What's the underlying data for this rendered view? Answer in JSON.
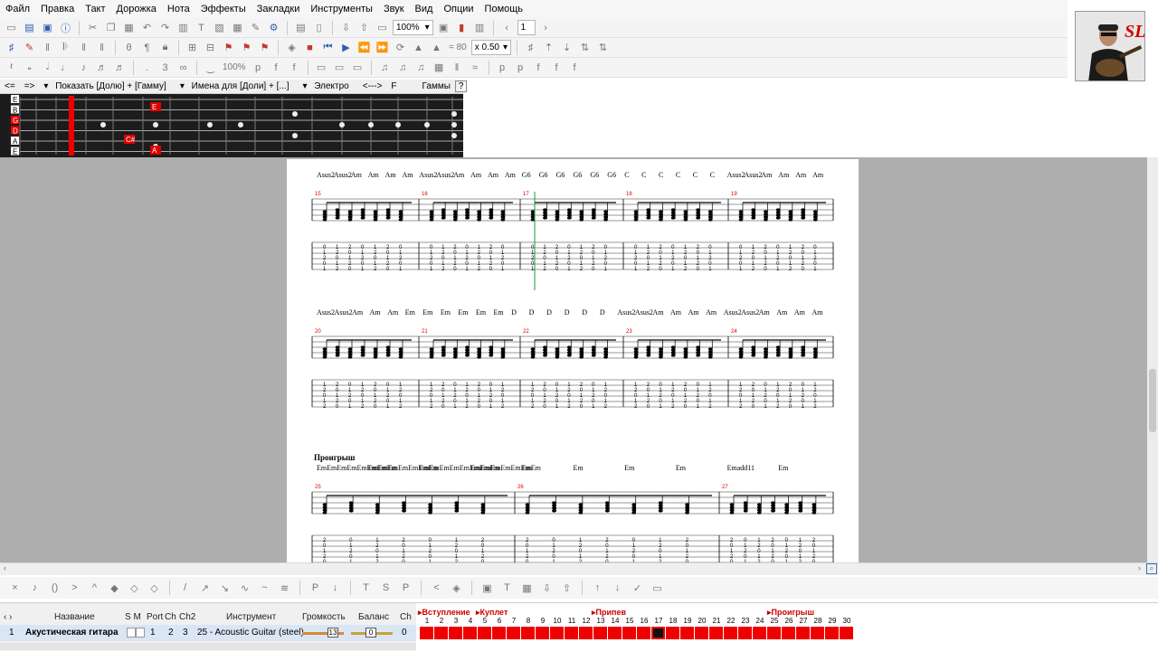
{
  "menu": [
    "Файл",
    "Правка",
    "Такт",
    "Дорожка",
    "Нота",
    "Эффекты",
    "Закладки",
    "Инструменты",
    "Звук",
    "Вид",
    "Опции",
    "Помощь"
  ],
  "toolbar1": {
    "zoom": "100%",
    "page": "1"
  },
  "toolbar2": {
    "tempo": "= 80",
    "speed": "x 0.50"
  },
  "toolbar3": {
    "zoom2": "100%"
  },
  "fretbar": {
    "prev": "<=",
    "next": "=>",
    "show": "Показать [Долю] + [Гамму]",
    "names": "Имена для [Доли] + [...]",
    "sound": "Электро",
    "arrows": "<--->",
    "key": "F",
    "scales": "Гаммы",
    "help": "?"
  },
  "fretboard": {
    "strings": [
      "E",
      "B",
      "G",
      "D",
      "A",
      "E"
    ],
    "notes": [
      "E",
      "C#",
      "A"
    ]
  },
  "score": {
    "row1_chords": [
      "Asus2",
      "Asus2",
      "Am",
      "Am",
      "Am",
      "Am",
      "Asus2",
      "Asus2",
      "Am",
      "Am",
      "Am",
      "Am",
      "G6",
      "G6",
      "G6",
      "G6",
      "G6",
      "G6",
      "C",
      "C",
      "C",
      "C",
      "C",
      "C",
      "Asus2",
      "Asus2",
      "Am",
      "Am",
      "Am",
      "Am"
    ],
    "row1_measures": [
      "15",
      "16",
      "17",
      "18",
      "19"
    ],
    "row2_chords": [
      "Asus2",
      "Asus2",
      "Am",
      "Am",
      "Am",
      "Em",
      "Em",
      "Em",
      "Em",
      "Em",
      "Em",
      "D",
      "D",
      "D",
      "D",
      "D",
      "D",
      "Asus2",
      "Asus2",
      "Am",
      "Am",
      "Am",
      "Am",
      "Asus2",
      "Asus2",
      "Am",
      "Am",
      "Am",
      "Am"
    ],
    "row2_measures": [
      "20",
      "21",
      "22",
      "23",
      "24"
    ],
    "section": "Проигрыш",
    "row3_chords": [
      "EmEmEmEmEmEmEmEm",
      "EmEmEmEmEmEmEm",
      "EmEmEmEmEmEmEmEm",
      "EmEmEmEmEmEmEm",
      "Em",
      "Em",
      "Em",
      "Em",
      "Emadd11",
      "Em"
    ],
    "row3_measures": [
      "25",
      "26",
      "27"
    ]
  },
  "track": {
    "headers": {
      "name": "Название",
      "sm": "S M",
      "port": "Port",
      "ch": "Ch",
      "ch2": "Ch2",
      "instrument": "Инструмент",
      "volume": "Громкость",
      "balance": "Баланс",
      "chn": "Ch"
    },
    "number": "1",
    "name": "Акустическая гитара",
    "port": "1",
    "ch": "2",
    "ch2": "3",
    "instrument": "25 - Acoustic Guitar (steel)",
    "volume": "13",
    "balance": "0",
    "chn": "0"
  },
  "markers": [
    "Вступление",
    "Куплет",
    "Припев",
    "Проигрыш"
  ],
  "timeline_selected": 17,
  "colors": {
    "accent": "#e00000",
    "paper": "#ffffff",
    "workspace": "#aeaeae"
  }
}
